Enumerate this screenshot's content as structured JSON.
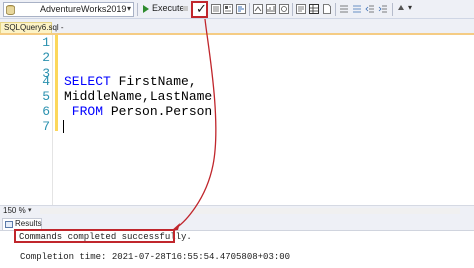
{
  "toolbar": {
    "database": "AdventureWorks2019",
    "execute_label": "Execute",
    "parse_icon": "check-icon"
  },
  "tab": {
    "label": "SQLQuery6.sql -"
  },
  "editor": {
    "lines": [
      {
        "num": "1",
        "text": ""
      },
      {
        "num": "2",
        "text": ""
      },
      {
        "num": "3",
        "text": ""
      },
      {
        "num": "4",
        "kw": "SELECT",
        "rest": " FirstName,"
      },
      {
        "num": "5",
        "text": "MiddleName,LastName"
      },
      {
        "num": "6",
        "kw": " FROM",
        "rest": " Person.Person"
      },
      {
        "num": "7",
        "text": ""
      }
    ]
  },
  "zoom": {
    "level": "150 %"
  },
  "results": {
    "tab_label": "Results",
    "message": "Commands completed successfully.",
    "completion": "Completion time: 2021-07-28T16:55:54.4705808+03:00"
  },
  "colors": {
    "annotation": "#c0262c",
    "keyword": "#0000ff",
    "line_number": "#2b91af"
  }
}
